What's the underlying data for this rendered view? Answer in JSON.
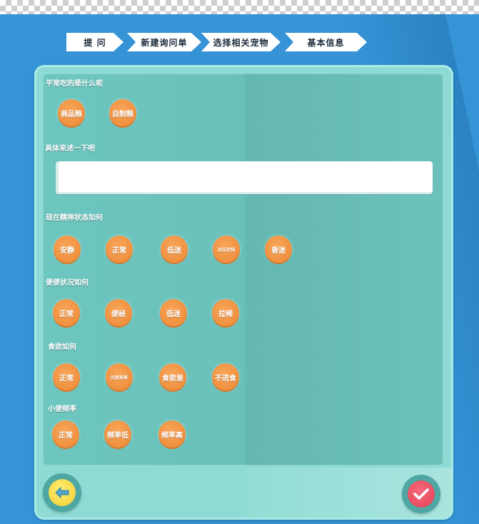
{
  "steps": [
    "提 问",
    "新建询问单",
    "选择相关宠物",
    "基本信息"
  ],
  "sections": {
    "food": {
      "label": "平常吃的是什么呢",
      "options": [
        "商品粮",
        "自制粮"
      ]
    },
    "describe": {
      "label": "具体来述一下吧",
      "value": "",
      "placeholder": ""
    },
    "spirit": {
      "label": "现在精神状态如何",
      "options": [
        "安静",
        "正常",
        "低迷",
        "反应迟钝",
        "昏迷"
      ]
    },
    "stool": {
      "label": "便便状况如何",
      "options": [
        "正常",
        "便秘",
        "低迷",
        "拉稀"
      ]
    },
    "appetite": {
      "label": "食欲如何",
      "options": [
        "正常",
        "比原来差",
        "食欲差",
        "不进食"
      ]
    },
    "urine": {
      "label": "小便频率",
      "options": [
        "正常",
        "频率低",
        "频率高"
      ]
    }
  },
  "footer": {
    "back_icon": "arrow-left-icon",
    "confirm_icon": "check-icon"
  },
  "colors": {
    "accent": "#f0903e",
    "panel": "#6ac1ba",
    "frame": "#8ddbd4",
    "background": "#3593d6",
    "confirm": "#e8475c",
    "back": "#f2d33a"
  }
}
